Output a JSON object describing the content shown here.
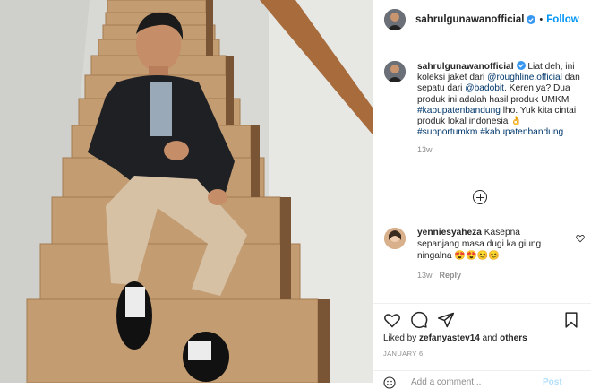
{
  "post": {
    "username": "sahrulgunawanofficial",
    "dot": "•",
    "follow_label": "Follow",
    "caption": {
      "username": "sahrulgunawanofficial",
      "t1": " Liat deh, ini koleksi jaket dari ",
      "m1": "@roughline.official",
      "t2": " dan sepatu dari ",
      "m2": "@badobit",
      "t3": ". Keren ya? Dua produk ini adalah hasil produk UMKM ",
      "h1": "#kabupatenbandung",
      "t4": " lho. Yuk kita cintai produk lokal indonesia ",
      "emoji": "👌",
      "h2": "#supportumkm",
      "h3": "#kabupatenbandung",
      "time": "13w"
    },
    "comment": {
      "username": "yenniesyaheza",
      "text": " Kasepna sepanjang masa dugi ka giung ningalna",
      "emoji": "😍😍😊😊",
      "time": "13w",
      "reply_label": "Reply"
    },
    "liked_prefix": "Liked by ",
    "liked_user": "zefanyastev14",
    "liked_mid": " and ",
    "liked_others": "others",
    "date": "JANUARY 6",
    "add_comment_placeholder": "Add a comment...",
    "post_label": "Post",
    "colors": {
      "accent": "#0095f6",
      "link": "#00376b",
      "muted": "#8e8e8e"
    }
  }
}
